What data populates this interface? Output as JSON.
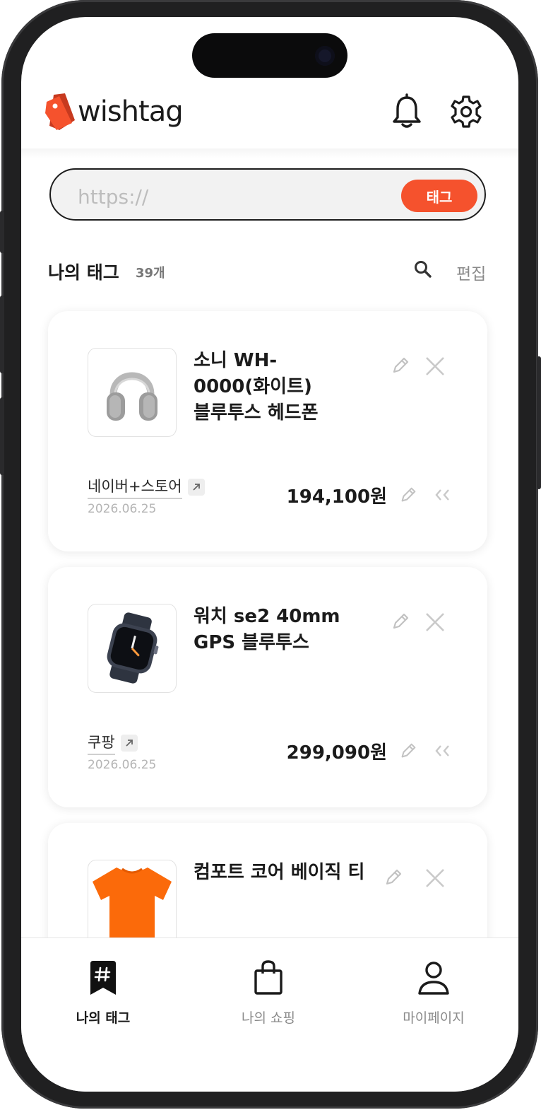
{
  "app": {
    "logo_text": "wishtag"
  },
  "url_bar": {
    "placeholder": "https://",
    "tag_button_label": "태그"
  },
  "section": {
    "title": "나의 태그",
    "count": "39개",
    "edit_label": "편집"
  },
  "cards": [
    {
      "name": "소니 WH-0000(화이트) 블루투스 헤드폰",
      "store": "네이버+스토어",
      "date": "2026.06.25",
      "price": "194,100원",
      "image": "headphones"
    },
    {
      "name": "워치 se2 40mm GPS 블루투스",
      "store": "쿠팡",
      "date": "2026.06.25",
      "price": "299,090원",
      "image": "smartwatch"
    },
    {
      "name": "컴포트 코어 베이직 티",
      "store": "",
      "date": "",
      "price": "",
      "image": "orange-tshirt"
    }
  ],
  "bottom_nav": [
    {
      "label": "나의 태그",
      "icon": "hashtag-bookmark-icon",
      "active": true
    },
    {
      "label": "나의 쇼핑",
      "icon": "shopping-bag-icon",
      "active": false
    },
    {
      "label": "마이페이지",
      "icon": "person-icon",
      "active": false
    }
  ],
  "colors": {
    "accent": "#f5522d",
    "text": "#1b1b1b",
    "muted": "#8a8a8a"
  }
}
